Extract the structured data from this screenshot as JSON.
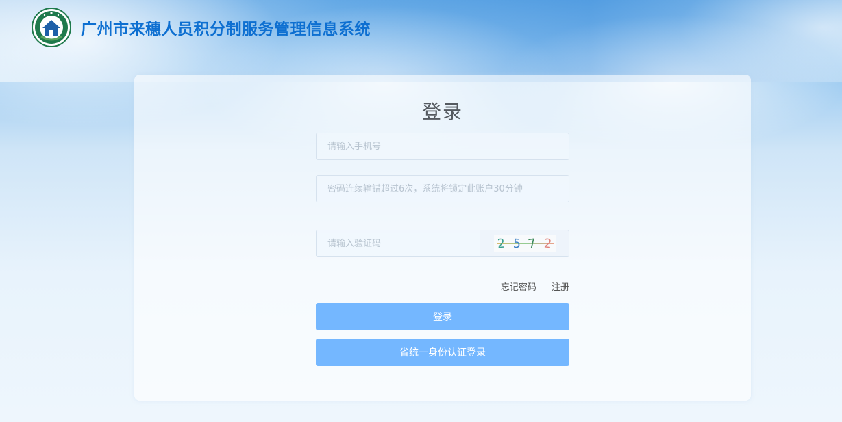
{
  "header": {
    "logo_icon": "guangzhou-emblem-icon",
    "title": "广州市来穗人员积分制服务管理信息系统"
  },
  "login": {
    "title": "登录",
    "phone_placeholder": "请输入手机号",
    "password_placeholder": "密码连续输错超过6次，系统将锁定此账户30分钟",
    "captcha_placeholder": "请输入验证码",
    "captcha_chars": [
      "2",
      "5",
      "7",
      "2"
    ],
    "forgot_password": "忘记密码",
    "register": "注册",
    "login_button": "登录",
    "unified_login_button": "省统一身份认证登录"
  },
  "colors": {
    "title_blue": "#0d6fd1",
    "button_blue": "#74b7ff",
    "logo_green": "#1f7a4c"
  }
}
